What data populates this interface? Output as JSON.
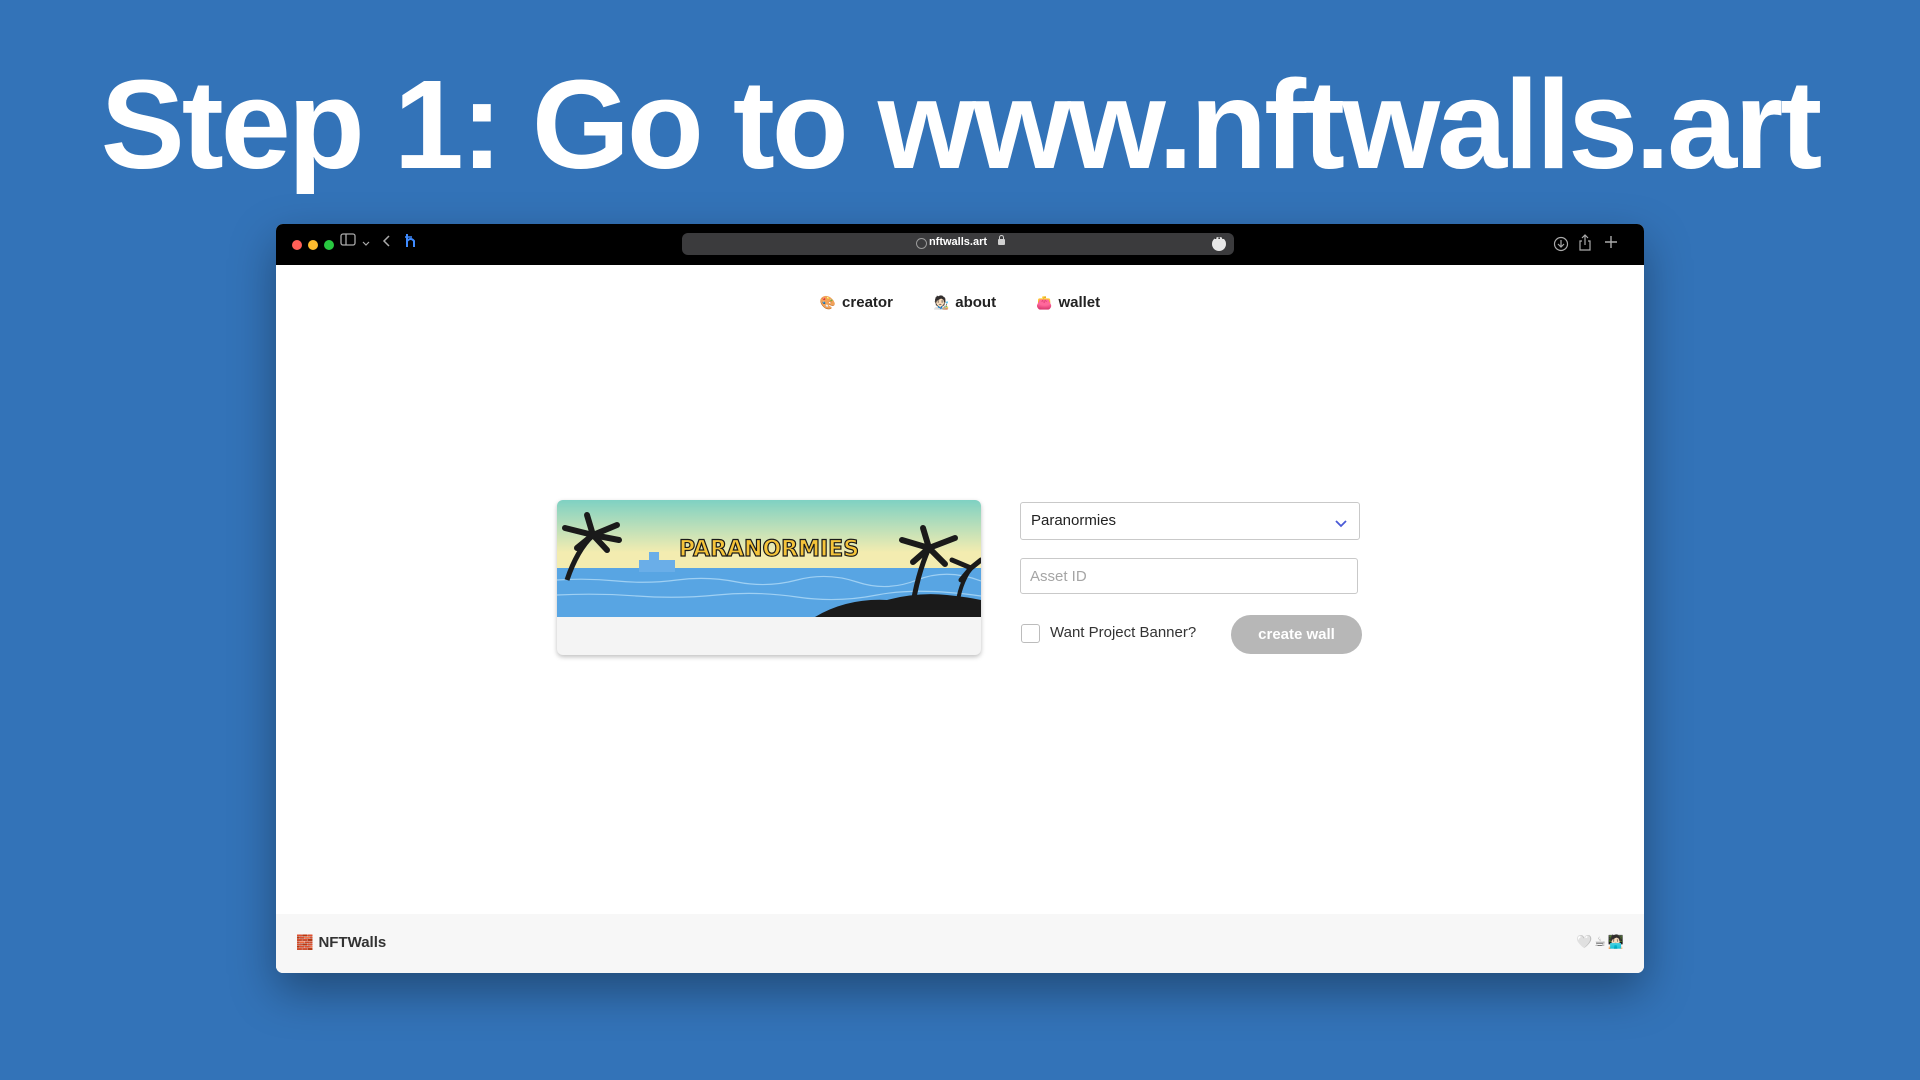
{
  "headline": "Step 1: Go to www.nftwalls.art",
  "browser": {
    "url": "nftwalls.art"
  },
  "nav": {
    "items": [
      {
        "icon": "🎨",
        "label": "creator"
      },
      {
        "icon": "🧑🏻‍🎨",
        "label": "about"
      },
      {
        "icon": "👛",
        "label": "wallet"
      }
    ]
  },
  "banner": {
    "title_text": "PARANORMIES"
  },
  "form": {
    "collection_select": "Paranormies",
    "asset_id_placeholder": "Asset ID",
    "asset_id_value": "",
    "banner_checkbox_label": "Want Project Banner?",
    "banner_checkbox_checked": false,
    "create_button_label": "create wall"
  },
  "footer": {
    "brand_icon": "🧱",
    "brand_label": "NFTWalls",
    "icons": "🤍☕🧑🏻‍💻"
  },
  "colors": {
    "background": "#3373b8",
    "button_disabled": "#b7b7b7",
    "titlebar": "#000000"
  }
}
